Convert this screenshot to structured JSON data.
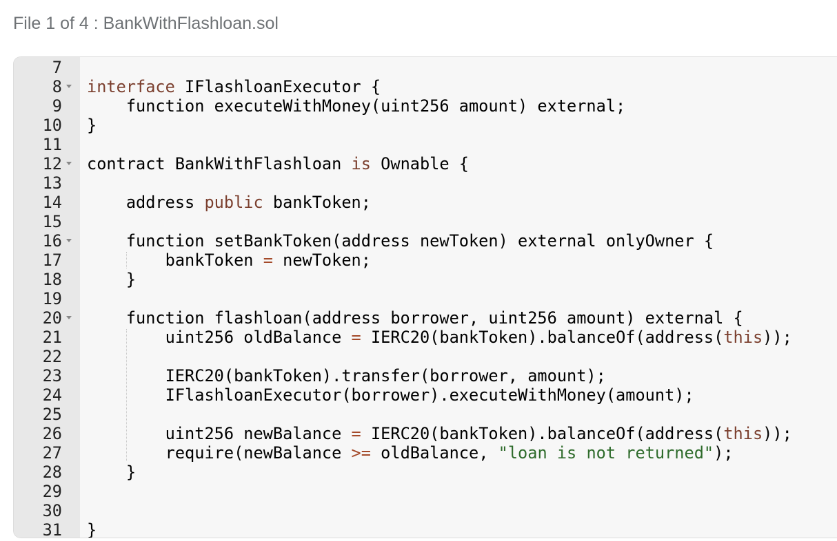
{
  "header": {
    "title": "File 1 of 4 : BankWithFlashloan.sol"
  },
  "editor": {
    "lines": [
      {
        "num": "7",
        "fold": false,
        "segs": []
      },
      {
        "num": "8",
        "fold": true,
        "segs": [
          {
            "t": "interface",
            "c": "kw"
          },
          {
            "t": " IFlashloanExecutor {",
            "c": ""
          }
        ]
      },
      {
        "num": "9",
        "fold": false,
        "segs": [
          {
            "t": "    function executeWithMoney(uint256 amount) external;",
            "c": ""
          }
        ]
      },
      {
        "num": "10",
        "fold": false,
        "segs": [
          {
            "t": "}",
            "c": ""
          }
        ]
      },
      {
        "num": "11",
        "fold": false,
        "segs": []
      },
      {
        "num": "12",
        "fold": true,
        "segs": [
          {
            "t": "contract BankWithFlashloan ",
            "c": ""
          },
          {
            "t": "is",
            "c": "kw"
          },
          {
            "t": " Ownable {",
            "c": ""
          }
        ]
      },
      {
        "num": "13",
        "fold": false,
        "segs": []
      },
      {
        "num": "14",
        "fold": false,
        "segs": [
          {
            "t": "    address ",
            "c": ""
          },
          {
            "t": "public",
            "c": "kw"
          },
          {
            "t": " bankToken;",
            "c": ""
          }
        ]
      },
      {
        "num": "15",
        "fold": false,
        "segs": []
      },
      {
        "num": "16",
        "fold": true,
        "segs": [
          {
            "t": "    function setBankToken(address newToken) external onlyOwner {",
            "c": ""
          }
        ]
      },
      {
        "num": "17",
        "fold": false,
        "segs": [
          {
            "t": "        bankToken ",
            "c": ""
          },
          {
            "t": "=",
            "c": "op"
          },
          {
            "t": " newToken;",
            "c": ""
          }
        ]
      },
      {
        "num": "18",
        "fold": false,
        "segs": [
          {
            "t": "    }",
            "c": ""
          }
        ]
      },
      {
        "num": "19",
        "fold": false,
        "segs": []
      },
      {
        "num": "20",
        "fold": true,
        "segs": [
          {
            "t": "    function flashloan(address borrower, uint256 amount) external {",
            "c": ""
          }
        ]
      },
      {
        "num": "21",
        "fold": false,
        "segs": [
          {
            "t": "        uint256 oldBalance ",
            "c": ""
          },
          {
            "t": "=",
            "c": "op"
          },
          {
            "t": " IERC20(bankToken).balanceOf(address(",
            "c": ""
          },
          {
            "t": "this",
            "c": "kw"
          },
          {
            "t": "));",
            "c": ""
          }
        ]
      },
      {
        "num": "22",
        "fold": false,
        "segs": []
      },
      {
        "num": "23",
        "fold": false,
        "segs": [
          {
            "t": "        IERC20(bankToken).transfer(borrower, amount);",
            "c": ""
          }
        ]
      },
      {
        "num": "24",
        "fold": false,
        "segs": [
          {
            "t": "        IFlashloanExecutor(borrower).executeWithMoney(amount);",
            "c": ""
          }
        ]
      },
      {
        "num": "25",
        "fold": false,
        "segs": []
      },
      {
        "num": "26",
        "fold": false,
        "segs": [
          {
            "t": "        uint256 newBalance ",
            "c": ""
          },
          {
            "t": "=",
            "c": "op"
          },
          {
            "t": " IERC20(bankToken).balanceOf(address(",
            "c": ""
          },
          {
            "t": "this",
            "c": "kw"
          },
          {
            "t": "));",
            "c": ""
          }
        ]
      },
      {
        "num": "27",
        "fold": false,
        "segs": [
          {
            "t": "        require(newBalance ",
            "c": ""
          },
          {
            "t": ">=",
            "c": "op"
          },
          {
            "t": " oldBalance, ",
            "c": ""
          },
          {
            "t": "\"loan is not returned\"",
            "c": "str"
          },
          {
            "t": ");",
            "c": ""
          }
        ]
      },
      {
        "num": "28",
        "fold": false,
        "segs": [
          {
            "t": "    }",
            "c": ""
          }
        ]
      },
      {
        "num": "29",
        "fold": false,
        "segs": []
      },
      {
        "num": "30",
        "fold": false,
        "segs": []
      },
      {
        "num": "31",
        "fold": false,
        "segs": [
          {
            "t": "}",
            "c": ""
          }
        ]
      }
    ]
  },
  "colors": {
    "keyword": "#7b3f2e",
    "string": "#2e6b2b",
    "operator": "#a44a2a",
    "gutter": "#e8e8e8",
    "editor_bg": "#f7f7f7",
    "header_text": "#6e7275"
  }
}
